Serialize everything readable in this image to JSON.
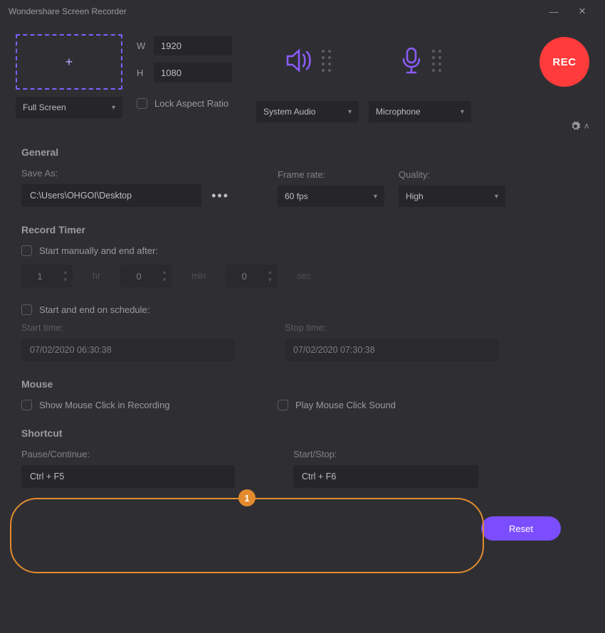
{
  "app": {
    "title": "Wondershare Screen Recorder"
  },
  "colors": {
    "accent": "#7c4dff",
    "record": "#ff3b3b",
    "callout": "#e38b2f"
  },
  "region": {
    "width": "1920",
    "height": "1080",
    "w_label": "W",
    "h_label": "H",
    "mode": "Full Screen",
    "lock_label": "Lock Aspect Ratio",
    "lock_checked": false
  },
  "audio": {
    "system": "System Audio",
    "mic": "Microphone"
  },
  "rec": {
    "label": "REC"
  },
  "general": {
    "title": "General",
    "save_as_label": "Save As:",
    "save_as_value": "C:\\Users\\OHGOI\\Desktop",
    "frame_rate_label": "Frame rate:",
    "frame_rate_value": "60 fps",
    "quality_label": "Quality:",
    "quality_value": "High"
  },
  "timer": {
    "title": "Record Timer",
    "manual_label": "Start manually and end after:",
    "manual_checked": false,
    "hr": "1",
    "hr_unit": "hr",
    "min": "0",
    "min_unit": "min",
    "sec": "0",
    "sec_unit": "sec",
    "schedule_label": "Start and end on schedule:",
    "schedule_checked": false,
    "start_label": "Start time:",
    "start_value": "07/02/2020 06:30:38",
    "stop_label": "Stop time:",
    "stop_value": "07/02/2020 07:30:38"
  },
  "mouse": {
    "title": "Mouse",
    "show_label": "Show Mouse Click in Recording",
    "show_checked": false,
    "sound_label": "Play Mouse Click Sound",
    "sound_checked": false
  },
  "shortcut": {
    "title": "Shortcut",
    "pause_label": "Pause/Continue:",
    "pause_value": "Ctrl + F5",
    "start_label": "Start/Stop:",
    "start_value": "Ctrl + F6"
  },
  "footer": {
    "reset": "Reset"
  },
  "callout": {
    "num": "1"
  }
}
